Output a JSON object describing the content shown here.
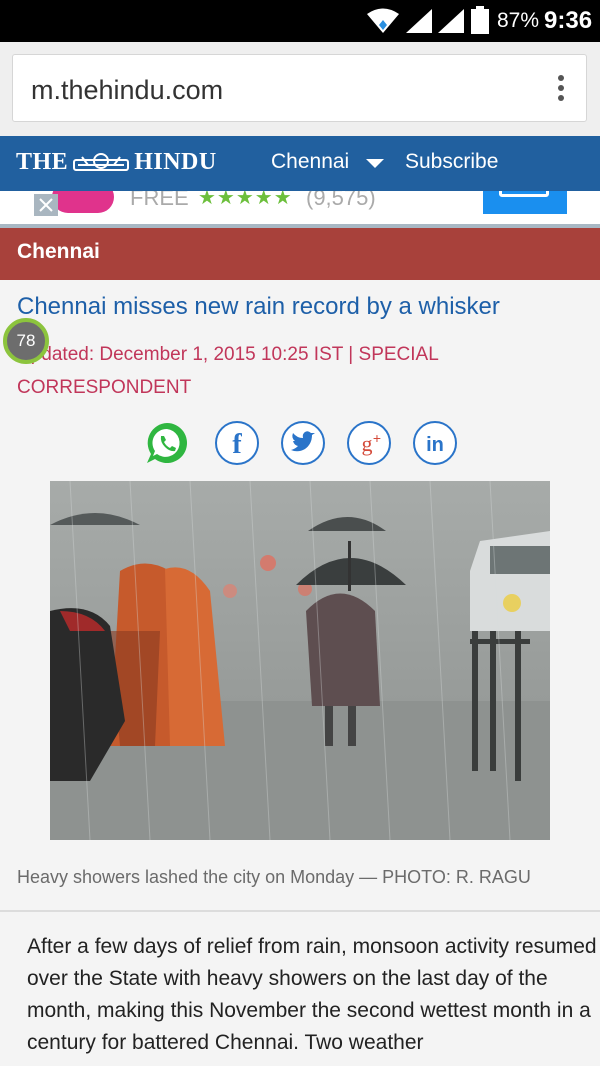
{
  "status_bar": {
    "battery": "87%",
    "time": "9:36"
  },
  "browser": {
    "url": "m.thehindu.com"
  },
  "site_header": {
    "logo_left": "THE",
    "logo_right": "HINDU",
    "city": "Chennai",
    "subscribe": "Subscribe"
  },
  "ad": {
    "text": "FREE",
    "stars": "★★★★★",
    "count": "(9,575)"
  },
  "section": {
    "title": "Chennai"
  },
  "article": {
    "headline": "Chennai misses new rain record by a whisker",
    "byline": "Updated: December 1, 2015 10:25 IST | SPECIAL CORRESPONDENT",
    "badge": "78",
    "caption": "Heavy showers lashed the city on Monday — PHOTO: R. RAGU",
    "body": "After a few days of relief from rain, monsoon activity resumed over the State with heavy showers on the last day of the month, making this November the second wettest month in a century for battered Chennai. Two weather"
  },
  "share_icons": [
    "whatsapp-icon",
    "facebook-icon",
    "twitter-icon",
    "google-plus-icon",
    "linkedin-icon"
  ],
  "colors": {
    "header_blue": "#21609f",
    "section_red": "#a8413b",
    "headline_blue": "#1d5fa8",
    "byline_pink": "#c1365a",
    "whatsapp_green": "#2fb640",
    "share_blue": "#2a74c9"
  }
}
